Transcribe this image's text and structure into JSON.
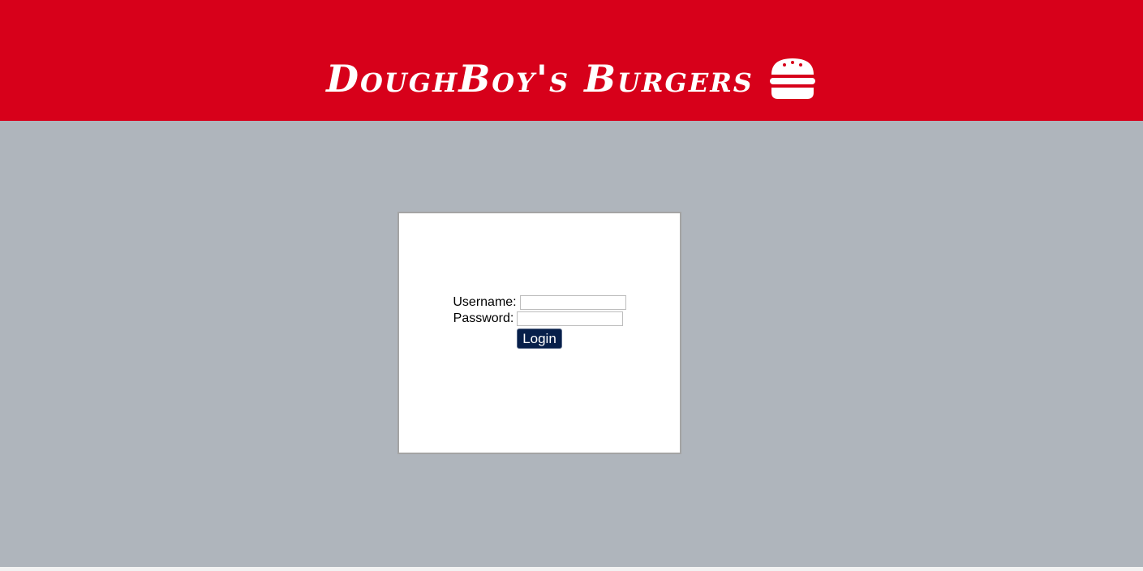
{
  "header": {
    "title": "DoughBoy's Burgers",
    "icon": "burger-icon",
    "background_color": "#d7001a",
    "text_color": "#ffffff"
  },
  "content": {
    "background_color": "#afb5bc"
  },
  "login": {
    "username_label": "Username:",
    "username_value": "",
    "password_label": "Password:",
    "password_value": "",
    "button_label": "Login",
    "button_color": "#071f4a"
  }
}
